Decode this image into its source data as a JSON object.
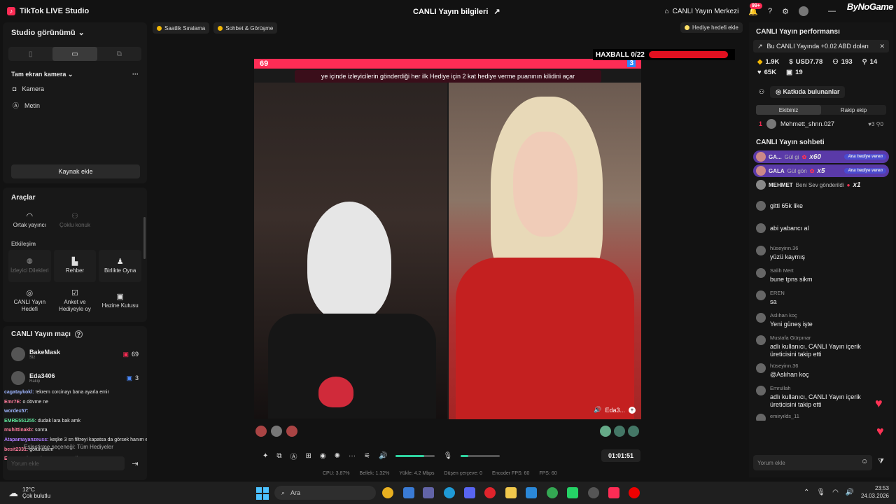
{
  "titlebar": {
    "app_title": "TikTok LIVE Studio",
    "center_title": "CANLI Yayın bilgileri",
    "live_center_label": "CANLI Yayın Merkezi",
    "notif_badge": "99+",
    "watermark": "ByNoGame"
  },
  "left": {
    "studio_view": "Studio görünümü",
    "scene_name": "Tam ekran kamera",
    "sources": [
      "Kamera",
      "Metin"
    ],
    "add_source": "Kaynak ekle"
  },
  "tools": {
    "title": "Araçlar",
    "row1": [
      "Ortak yayıncı",
      "Çoklu konuk"
    ],
    "section": "Etkileşim",
    "row2": [
      "İzleyici Dilekleri",
      "Rehber",
      "Birlikte Oyna"
    ],
    "row3": [
      "CANLI Yayın Hedefi",
      "Anket ve Hediyeyle oy",
      "Hazine Kutusu"
    ]
  },
  "match": {
    "title": "CANLI Yayın maçı",
    "players": [
      {
        "name": "BakeMask",
        "sub": "Siz",
        "score": "69"
      },
      {
        "name": "Eda3406",
        "sub": "Rakip",
        "score": "3"
      }
    ],
    "chat": [
      {
        "user": "cagataykokl:",
        "text": "!ekrem corcinayı bana ayarla emir",
        "color": "#9fb6ff"
      },
      {
        "user": "Emr7E:",
        "text": "o dövme ne",
        "color": "#ff7b9c"
      },
      {
        "user": "wordex57:",
        "text": "",
        "color": "#9fb6ff"
      },
      {
        "user": "EMRE551255:",
        "text": "dudak lara bak amk",
        "color": "#5fe39a"
      },
      {
        "user": "muhittinakb:",
        "text": "sonra",
        "color": "#ff7b9c"
      },
      {
        "user": "Atapamayanzeuss:",
        "text": "keşke 3 sn filtreyi kapatsa da görsek hanım efendiyi",
        "color": "#b07bff"
      },
      {
        "user": "besit2331:",
        "text": "götünüskm",
        "color": "#ff7b9c"
      },
      {
        "user": "Emr7E:",
        "text": "!ekrem dövme göstermeli",
        "color": "#ff7b9c"
      }
    ],
    "overlay_text": "Eşleştirme seçeneği: Tüm Hediyeler",
    "comment_placeholder": "Yorum ekle"
  },
  "pills": [
    "Saatlik Sıralama",
    "Sohbet & Görüşme"
  ],
  "gift_goal": "Hediye hedefi ekle",
  "stage": {
    "left_score": "69",
    "right_score": "3",
    "ticker": "ye içinde izleyicilerin gönderdiği her ilk Hediye için 2 kat hediye verme puanının kilidini açar",
    "guest_name": "Eda3...",
    "haxball": "HAXBALL 0/22"
  },
  "controls": {
    "timer": "01:01:51",
    "volume": 0.72,
    "mic": 0.2,
    "stats": [
      "CPU: 3.87%",
      "Bellek: 1.32%",
      "Yükle: 4.2 Mbps",
      "Düşen çerçeve: 0",
      "Encoder FPS: 60",
      "FPS: 60"
    ]
  },
  "right": {
    "perf_title": "CANLI Yayın performansı",
    "notif": "Bu CANLI Yayında +0.02 ABD doları",
    "kpis": [
      "1.9K",
      "USD7.78",
      "193",
      "14",
      "65K",
      "19"
    ],
    "contrib_label": "Katkıda bulunanlar",
    "team_tabs": [
      "Ekibiniz",
      "Rakip ekip"
    ],
    "rank": {
      "pos": "1",
      "name": "Mehmett_shnn.027",
      "a": "3",
      "b": "0"
    },
    "chat_title": "CANLI Yayın sohbeti",
    "gifts": [
      {
        "user": "GA...",
        "text": "Gül gi",
        "mult": "x60",
        "tag": "Ana hediye veren"
      },
      {
        "user": "GALA",
        "text": "Gül gön",
        "mult": "x5",
        "tag": "Ana hediye veren"
      },
      {
        "user": "MEHMET",
        "text": "Beni Sev gönderildi",
        "mult": "x1",
        "tag": ""
      }
    ],
    "chat": [
      {
        "name": "",
        "text": "gitti 65k like"
      },
      {
        "name": "",
        "text": "abi yabancı al"
      },
      {
        "name": "hüseyinn.36",
        "text": "yüzü kaymış"
      },
      {
        "name": "Salih Mert",
        "text": "bune tpns sikm"
      },
      {
        "name": "EREN",
        "text": "sa"
      },
      {
        "name": "Aslıhan koç",
        "text": "Yeni güneş işte"
      },
      {
        "name": "Mustafa Gürpınar",
        "text": "adlı kullanıcı, CANLI Yayın içerik üreticisini takip etti"
      },
      {
        "name": "hüseyinn.36",
        "text": "@Aslıhan koç"
      },
      {
        "name": "Emrullah",
        "text": "adlı kullanıcı, CANLI Yayın içerik üreticisini takip etti"
      },
      {
        "name": "emiryılds_11",
        "text": "katıldı"
      }
    ],
    "comment_placeholder": "Yorum ekle"
  },
  "taskbar": {
    "temp": "12°C",
    "weather": "Çok bulutlu",
    "search": "Ara",
    "time": "23:53",
    "date": "24.03.2026"
  }
}
